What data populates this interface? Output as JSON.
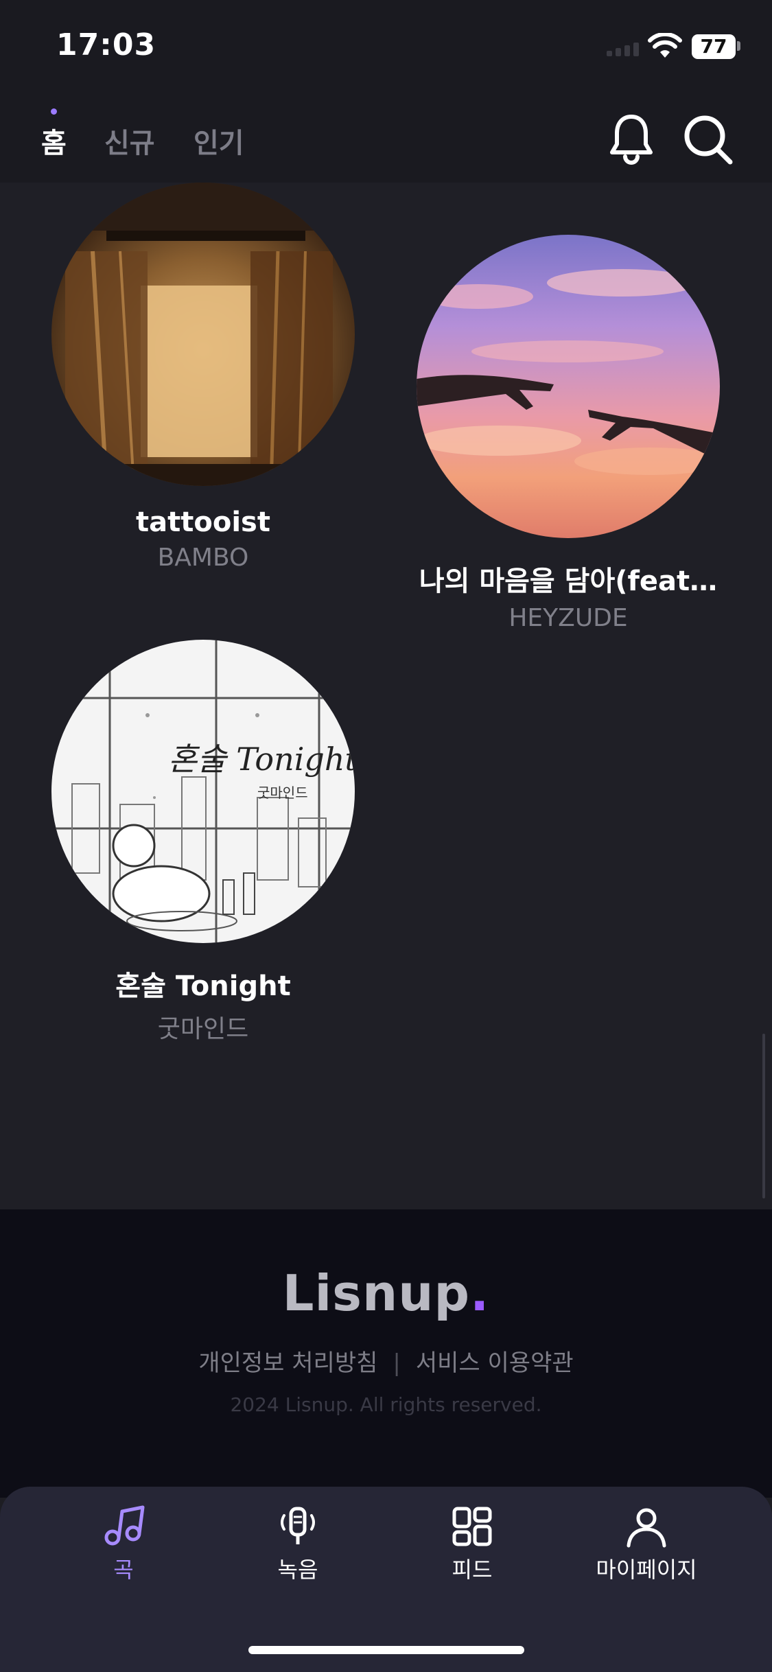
{
  "status_bar": {
    "time": "17:03",
    "battery": "77"
  },
  "top_nav": {
    "tabs": [
      {
        "label": "홈",
        "active": true
      },
      {
        "label": "신규",
        "active": false
      },
      {
        "label": "인기",
        "active": false
      }
    ],
    "icons": [
      "bell-icon",
      "search-icon"
    ]
  },
  "songs": [
    {
      "title": "tattooist",
      "artist": "BAMBO"
    },
    {
      "title": "나의 마음을 담아(feat…",
      "artist": "HEYZUDE"
    },
    {
      "title": "혼술 Tonight",
      "artist": "굿마인드"
    }
  ],
  "footer": {
    "logo": "Lisnup",
    "logo_dot": ".",
    "links": [
      "개인정보 처리방침",
      "서비스 이용약관"
    ],
    "separator": "|",
    "copyright": "2024 Lisnup. All rights reserved."
  },
  "tab_bar": {
    "items": [
      {
        "label": "곡",
        "icon": "music-note-icon",
        "active": true
      },
      {
        "label": "녹음",
        "icon": "microphone-icon",
        "active": false
      },
      {
        "label": "피드",
        "icon": "grid-icon",
        "active": false
      },
      {
        "label": "마이페이지",
        "icon": "person-icon",
        "active": false
      }
    ]
  },
  "colors": {
    "accent": "#9b7bff",
    "background": "#1f1f26",
    "footer": "#0d0d16",
    "tab_bar": "#262636"
  }
}
